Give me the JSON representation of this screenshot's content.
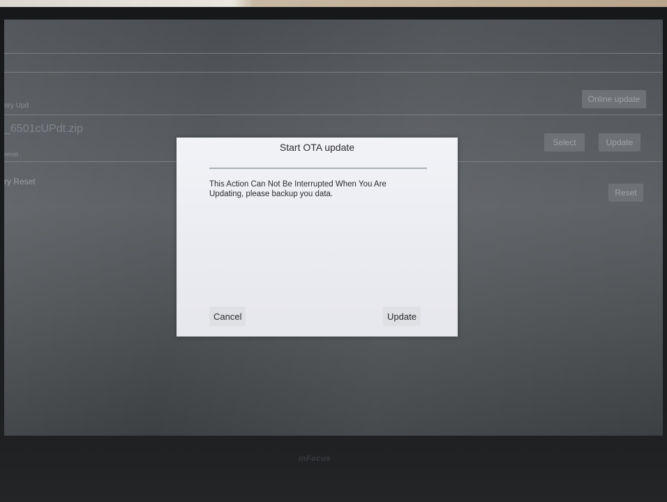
{
  "background": {
    "section_label_1": "ory Upd",
    "file_name": "_6501cUPdt.zip",
    "section_label_2": "reset",
    "factory_reset_label": "ry Reset",
    "online_update_button": "Online update",
    "select_button": "Select",
    "update_button": "Update",
    "reset_button": "Reset"
  },
  "dialog": {
    "title": "Start OTA update",
    "message_line1": "This Action Can Not Be Interrupted When You Are",
    "message_line2": "Updating, please backup you data.",
    "cancel_label": "Cancel",
    "update_label": "Update"
  },
  "device": {
    "brand": "InFocus"
  },
  "colors": {
    "dialog_bg": "#eceef2",
    "screen_bg": "#55585c",
    "bezel": "#1b1c1e"
  }
}
